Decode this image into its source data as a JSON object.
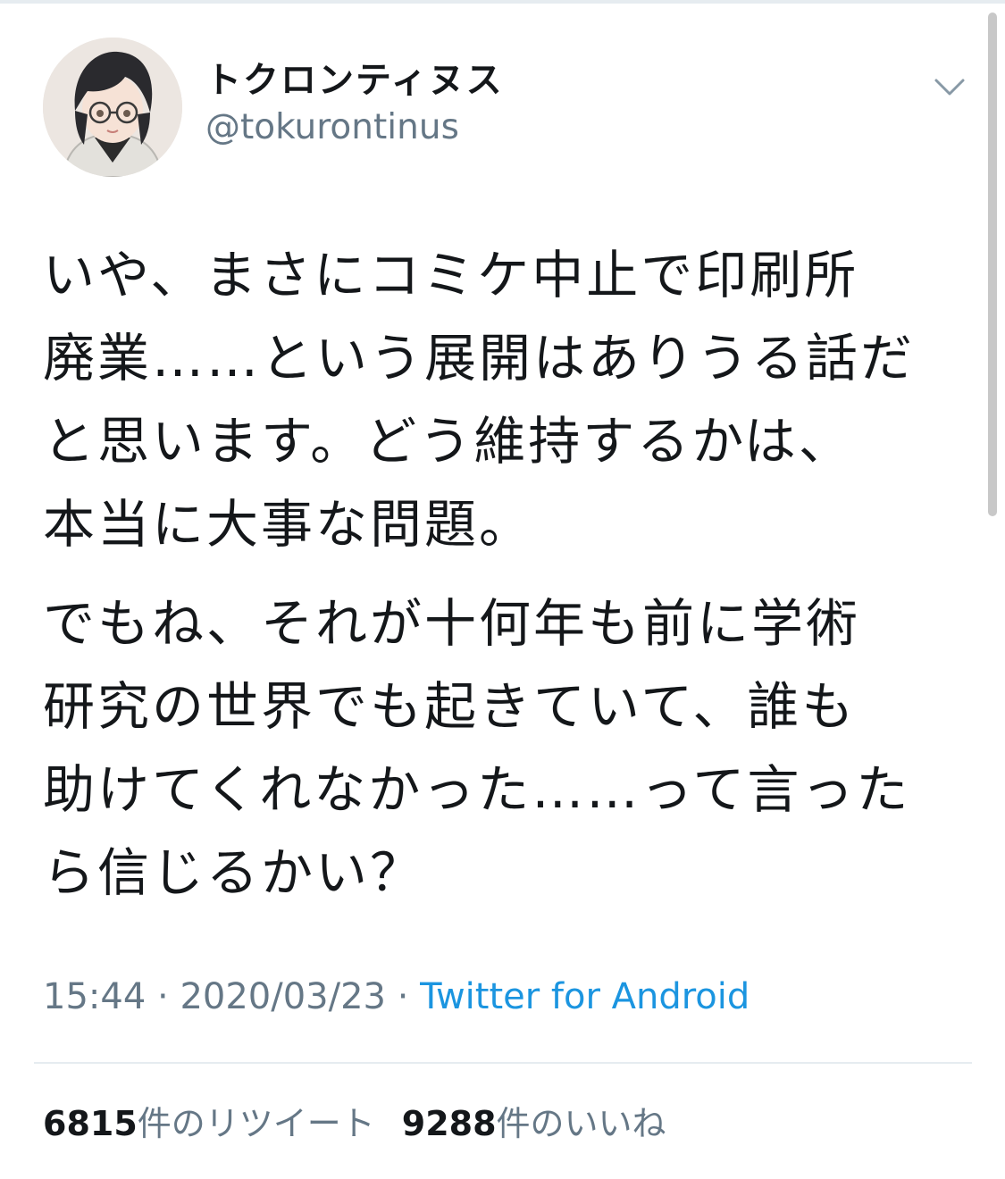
{
  "colors": {
    "text_primary": "#14171a",
    "text_secondary": "#657786",
    "link": "#1b95e0",
    "divider": "#e6ecf0"
  },
  "author": {
    "display_name": "トクロンティヌス",
    "handle": "@tokurontinus",
    "avatar_icon": "avatar-illustration-icon",
    "menu_icon": "chevron-down-icon"
  },
  "tweet": {
    "paragraphs": [
      "いや、まさにコミケ中止で印刷所\n廃業……という展開はありうる話だ\nと思います。どう維持するかは、\n本当に大事な問題。",
      "でもね、それが十何年も前に学術\n研究の世界でも起きていて、誰も\n助けてくれなかった……って言った\nら信じるかい？"
    ],
    "time": "15:44",
    "separator": "·",
    "date": "2020/03/23",
    "source": "Twitter for Android"
  },
  "stats": {
    "retweet_count": "6815",
    "retweet_label": "件のリツイート",
    "like_count": "9288",
    "like_label": "件のいいね"
  }
}
